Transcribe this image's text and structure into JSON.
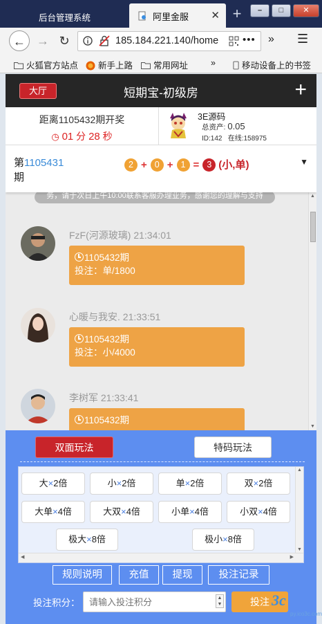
{
  "browser": {
    "tabs": [
      {
        "label": "后台管理系统",
        "active": false
      },
      {
        "label": "阿里金服",
        "active": true
      }
    ],
    "url": "185.184.221.140/home",
    "url_more": "•••",
    "bookmarks": [
      "火狐官方站点",
      "新手上路",
      "常用网址",
      "移动设备上的书签"
    ],
    "overflow_glyph": "»"
  },
  "app": {
    "hall_button": "大厅",
    "title": "短期宝-初级房",
    "plus": "+"
  },
  "countdown": {
    "label": "距离1105432期开奖",
    "minutes": "01",
    "min_unit": "分",
    "seconds": "28",
    "sec_unit": "秒"
  },
  "user": {
    "name": "3E源码",
    "assets_label": "总资产:",
    "assets_value": "0.05",
    "id_line": "ID:142",
    "online_line": "在线:158975"
  },
  "last_result": {
    "prefix": "第",
    "period": "1105431",
    "suffix": "期",
    "balls": [
      "2",
      "0",
      "1"
    ],
    "plus": "+",
    "equals": "=",
    "sum": "3",
    "result": "(小,单)"
  },
  "chat": {
    "notice": "务，请于次日上午10:00联系客服办理业务，感谢您的理解与支持",
    "messages": [
      {
        "user": "FzF(河源玻璃)",
        "time": "21:34:01",
        "period": "1105432期",
        "bet": "投注：单/1800"
      },
      {
        "user": "心暖与我安.",
        "time": "21:33:51",
        "period": "1105432期",
        "bet": "投注：小/4000"
      },
      {
        "user": "李树军",
        "time": "21:33:41",
        "period": "1105432期",
        "bet": ""
      }
    ]
  },
  "betting": {
    "tab_double": "双面玩法",
    "tab_special": "特码玩法",
    "options": [
      {
        "label": "大",
        "mult": "2倍"
      },
      {
        "label": "小",
        "mult": "2倍"
      },
      {
        "label": "单",
        "mult": "2倍"
      },
      {
        "label": "双",
        "mult": "2倍"
      },
      {
        "label": "大单",
        "mult": "4倍"
      },
      {
        "label": "大双",
        "mult": "4倍"
      },
      {
        "label": "小单",
        "mult": "4倍"
      },
      {
        "label": "小双",
        "mult": "4倍"
      },
      {
        "label": "极大",
        "mult": "8倍"
      },
      {
        "label": "极小",
        "mult": "8倍"
      }
    ],
    "times": "×",
    "actions": [
      "规则说明",
      "充值",
      "提现",
      "投注记录"
    ],
    "stake_label": "投注积分：",
    "stake_placeholder": "请输入投注积分",
    "bet_button": "投注"
  },
  "watermark": {
    "big": "3c",
    "small": "py.ico3c.com"
  },
  "colors": {
    "header_bg": "#262626",
    "accent_red": "#c8242a",
    "bubble_orange": "#eea345",
    "panel_blue": "#5d8ef0",
    "period_blue": "#3a8bd8"
  }
}
